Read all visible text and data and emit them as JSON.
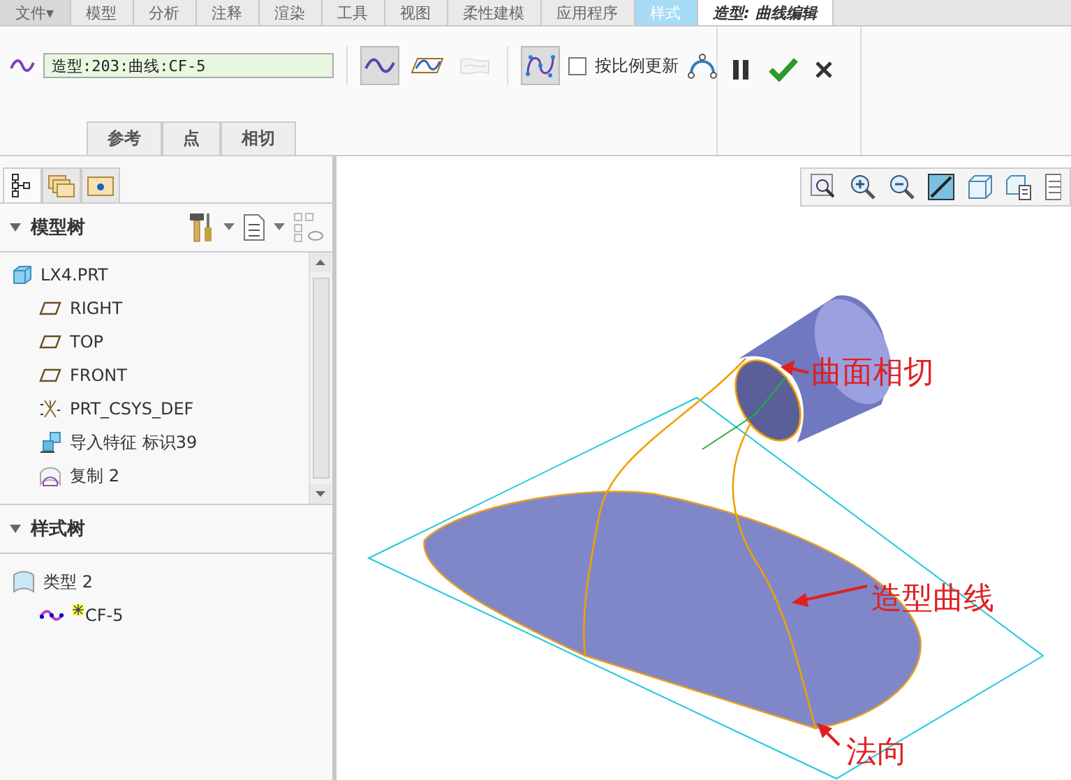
{
  "menu_tabs": [
    {
      "label": "文件▾",
      "kind": "file",
      "selected": false
    },
    {
      "label": "模型",
      "kind": "normal",
      "selected": false
    },
    {
      "label": "分析",
      "kind": "normal",
      "selected": false
    },
    {
      "label": "注释",
      "kind": "normal",
      "selected": false
    },
    {
      "label": "渲染",
      "kind": "normal",
      "selected": false
    },
    {
      "label": "工具",
      "kind": "normal",
      "selected": false
    },
    {
      "label": "视图",
      "kind": "normal",
      "selected": false
    },
    {
      "label": "柔性建模",
      "kind": "normal",
      "selected": false
    },
    {
      "label": "应用程序",
      "kind": "normal",
      "selected": false
    },
    {
      "label": "样式",
      "kind": "context",
      "selected": false
    },
    {
      "label": "造型: 曲线编辑",
      "kind": "normal",
      "selected": true
    }
  ],
  "ribbon": {
    "curve_field": {
      "value": "造型:203:曲线:CF-5"
    },
    "tools": [
      {
        "kind": "free-curve",
        "selected": true,
        "disabled": false
      },
      {
        "kind": "planar-curve",
        "selected": false,
        "disabled": false
      },
      {
        "kind": "surface-curve",
        "selected": false,
        "disabled": true
      },
      {
        "kind": "control-points",
        "selected": true,
        "disabled": false
      }
    ],
    "checkbox": {
      "label": "按比例更新",
      "checked": false
    },
    "subtabs": [
      {
        "label": "参考",
        "selected": false
      },
      {
        "label": "点",
        "selected": false
      },
      {
        "label": "相切",
        "selected": false
      }
    ]
  },
  "left_panel": {
    "tabs": [
      {
        "kind": "tree",
        "selected": true
      },
      {
        "kind": "folders",
        "selected": false
      },
      {
        "kind": "favorites",
        "selected": false
      }
    ],
    "model_tree": {
      "title": "模型树",
      "expanded": true,
      "items": [
        {
          "label": "LX4.PRT",
          "kind": "part",
          "children": [
            {
              "label": "RIGHT",
              "kind": "plane"
            },
            {
              "label": "TOP",
              "kind": "plane"
            },
            {
              "label": "FRONT",
              "kind": "plane"
            },
            {
              "label": "PRT_CSYS_DEF",
              "kind": "csys"
            },
            {
              "label": "导入特征 标识39",
              "kind": "import"
            },
            {
              "label": "复制 2",
              "kind": "copy"
            }
          ]
        }
      ]
    },
    "style_tree": {
      "title": "样式树",
      "expanded": true,
      "items": [
        {
          "label": "类型 2",
          "kind": "style",
          "children": [
            {
              "label": "CF-5",
              "kind": "curve",
              "active": true
            }
          ]
        }
      ]
    }
  },
  "graphics": {
    "annotations": [
      {
        "text": "曲面相切"
      },
      {
        "text": "造型曲线"
      },
      {
        "text": "法向"
      }
    ]
  }
}
